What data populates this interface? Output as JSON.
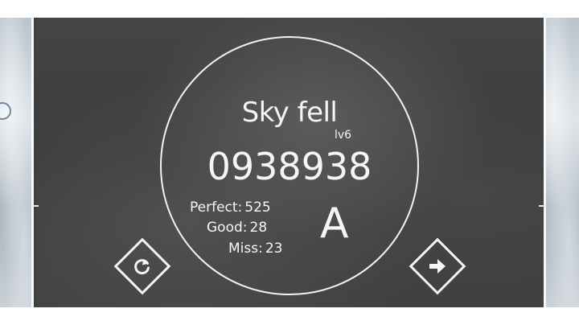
{
  "song": {
    "title": "Sky fell",
    "level": "lv6"
  },
  "result": {
    "score": "0938938",
    "grade": "A",
    "stats": [
      {
        "label": "Perfect:",
        "value": "525"
      },
      {
        "label": "Good:",
        "value": "28"
      },
      {
        "label": "Miss:",
        "value": "23"
      }
    ]
  },
  "controls": {
    "retry_icon": "retry-icon",
    "next_icon": "arrow-right-icon"
  },
  "colors": {
    "text": "#f5f5f5",
    "overlay": "#3f3f3f"
  }
}
